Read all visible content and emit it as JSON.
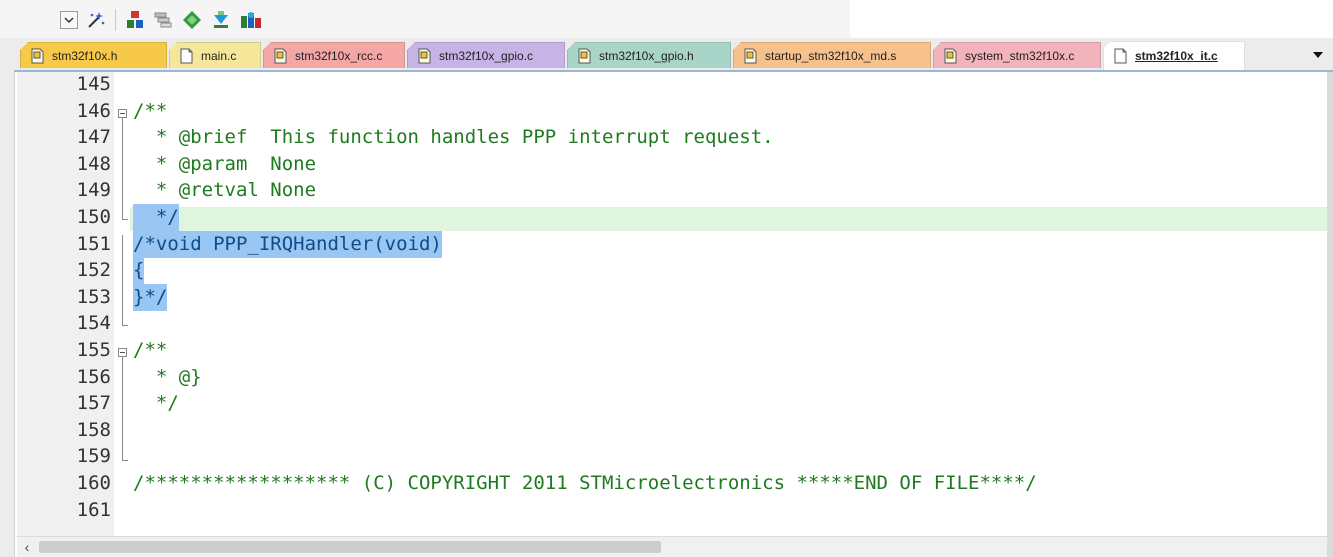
{
  "toolbar": {
    "buttons": [
      {
        "name": "dropdown-arrow-icon"
      },
      {
        "name": "wand-icon"
      },
      {
        "name": "insert-icon"
      },
      {
        "name": "stack-icon"
      },
      {
        "name": "diamond-icon"
      },
      {
        "name": "download-icon"
      },
      {
        "name": "books-icon"
      }
    ]
  },
  "tabs": [
    {
      "label": "stm32f10x.h",
      "color": "#f7c948",
      "icon": "header-file-icon"
    },
    {
      "label": "main.c",
      "color": "#f4e79a",
      "icon": "c-file-icon"
    },
    {
      "label": "stm32f10x_rcc.c",
      "color": "#f4a7a5",
      "icon": "header-file-icon"
    },
    {
      "label": "stm32f10x_gpio.c",
      "color": "#c7b3e6",
      "icon": "header-file-icon"
    },
    {
      "label": "stm32f10x_gpio.h",
      "color": "#a8d5c7",
      "icon": "header-file-icon"
    },
    {
      "label": "startup_stm32f10x_md.s",
      "color": "#f6c18a",
      "icon": "header-file-icon"
    },
    {
      "label": "system_stm32f10x.c",
      "color": "#f2b3bd",
      "icon": "header-file-icon"
    },
    {
      "label": "stm32f10x_it.c",
      "color": "#ffffff",
      "icon": "c-file-icon",
      "active": true
    }
  ],
  "editor": {
    "lines": [
      {
        "num": "145",
        "text": ""
      },
      {
        "num": "146",
        "text": "/**"
      },
      {
        "num": "147",
        "text": "  * @brief  This function handles PPP interrupt request."
      },
      {
        "num": "148",
        "text": "  * @param  None"
      },
      {
        "num": "149",
        "text": "  * @retval None"
      },
      {
        "num": "150",
        "text": "  */"
      },
      {
        "num": "151",
        "text": "/*void PPP_IRQHandler(void)"
      },
      {
        "num": "152",
        "text": "{"
      },
      {
        "num": "153",
        "text": "}*/"
      },
      {
        "num": "154",
        "text": ""
      },
      {
        "num": "155",
        "text": "/**"
      },
      {
        "num": "156",
        "text": "  * @}"
      },
      {
        "num": "157",
        "text": "  */"
      },
      {
        "num": "158",
        "text": ""
      },
      {
        "num": "159",
        "text": ""
      },
      {
        "num": "160",
        "text": "/****************** (C) COPYRIGHT 2011 STMicroelectronics *****END OF FILE****/"
      },
      {
        "num": "161",
        "text": ""
      }
    ],
    "colors": {
      "comment": "#1f7a1f",
      "selection": "#99c6f2",
      "current_line": "#dff5e0",
      "gutter": "#f0f0f0"
    }
  },
  "scrollbar": {
    "left_arrow": "‹"
  }
}
